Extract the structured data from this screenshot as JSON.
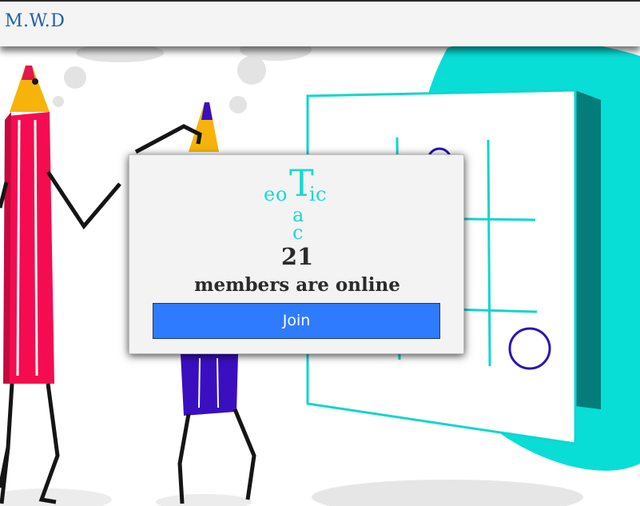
{
  "header": {
    "brand": "M.W.D"
  },
  "modal": {
    "logo_letters": {
      "e": "e",
      "o": "o",
      "T": "T",
      "i": "i",
      "c": "c",
      "a": "a",
      "c2": "c"
    },
    "members_count": "21",
    "members_text": "members are online",
    "join_label": "Join"
  },
  "colors": {
    "brand_text": "#1f5fa8",
    "logo": "#19d9d2",
    "join_button": "#2e7bff",
    "teal_blob": "#08ddd6",
    "pencil_red": "#f50c50",
    "pencil_blue": "#3a0fc0",
    "pencil_tip": "#f6b40a"
  },
  "icons": [
    "pencil-character-red",
    "pencil-character-blue",
    "tic-tac-toe-board",
    "thought-bubble"
  ]
}
